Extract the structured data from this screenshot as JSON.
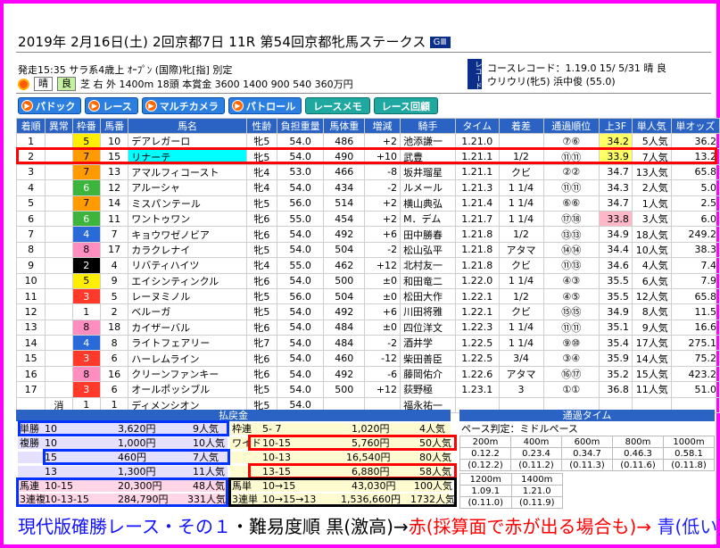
{
  "header": {
    "title": "2019年  2月16日(土)   2回京都7日  11R 第54回京都牝馬ステークス",
    "grade": "GⅢ"
  },
  "conditions": {
    "line1": "発走15:35  サラ系4歳上 ｵｰﾌﾟﾝ (国際)牝[指] 別定",
    "weather": "晴",
    "going": "良",
    "line2": "芝 右 外 1400m 18頭 本賞金 3600 1400 900 540 360万円"
  },
  "record": {
    "badge": "レコード",
    "line1": "コースレコード：1.19.0  15/ 5/31 晴 良",
    "line2": "ウリウリ(牝5)  浜中俊  (55.0)"
  },
  "nav": [
    {
      "label": "パドック",
      "icon": "play-icon"
    },
    {
      "label": "レース",
      "icon": "play-icon"
    },
    {
      "label": "マルチカメラ",
      "icon": "play-icon"
    },
    {
      "label": "パトロール",
      "icon": "play-icon"
    },
    {
      "label": "レースメモ",
      "icon": ""
    },
    {
      "label": "レース回顧",
      "icon": ""
    }
  ],
  "columns": [
    "着順",
    "異常",
    "枠番",
    "馬番",
    "馬名",
    "性齢",
    "負担重量",
    "馬体重",
    "増減",
    "騎手",
    "タイム",
    "着差",
    "通過順位",
    "上3F",
    "単人気",
    "単オッズ"
  ],
  "rows": [
    [
      "1",
      "",
      "5",
      "10",
      "デアレガーロ",
      "牝5",
      "54.0",
      "486",
      "+2",
      "池添謙一",
      "1.21.0",
      "",
      "⑦⑥",
      "34.2",
      "5人気",
      "36.2"
    ],
    [
      "2",
      "",
      "7",
      "15",
      "リナーテ",
      "牝5",
      "54.0",
      "490",
      "+10",
      "武豊",
      "1.21.1",
      "1/2",
      "⑪⑪",
      "33.9",
      "7人気",
      "13.2"
    ],
    [
      "3",
      "",
      "7",
      "13",
      "アマルフィコースト",
      "牝4",
      "53.0",
      "466",
      "-8",
      "坂井瑠星",
      "1.21.1",
      "クビ",
      "②②",
      "34.7",
      "13人気",
      "65.8"
    ],
    [
      "4",
      "",
      "6",
      "12",
      "アルーシャ",
      "牝4",
      "54.0",
      "434",
      "-2",
      "ルメール",
      "1.21.3",
      "1 1/4",
      "⑪⑪",
      "34.3",
      "2人気",
      "5.0"
    ],
    [
      "5",
      "",
      "7",
      "14",
      "ミスパンテール",
      "牝5",
      "56.0",
      "514",
      "+2",
      "横山典弘",
      "1.21.4",
      "1 1/4",
      "⑥⑥",
      "34.7",
      "1人気",
      "2.5"
    ],
    [
      "6",
      "",
      "6",
      "11",
      "ワントゥワン",
      "牝6",
      "55.0",
      "454",
      "+2",
      "M．デム",
      "1.21.7",
      "1 1/4",
      "⑰⑱",
      "33.8",
      "3人気",
      "6.0"
    ],
    [
      "7",
      "",
      "4",
      "7",
      "キョウワゼノビア",
      "牝6",
      "54.0",
      "492",
      "+6",
      "田中勝春",
      "1.21.8",
      "1/2",
      "⑬⑬",
      "34.9",
      "18人気",
      "249.2"
    ],
    [
      "8",
      "",
      "8",
      "17",
      "カラクレナイ",
      "牝5",
      "54.0",
      "504",
      "-2",
      "松山弘平",
      "1.21.8",
      "アタマ",
      "⑭⑭",
      "34.4",
      "10人気",
      "38.3"
    ],
    [
      "9",
      "",
      "2",
      "4",
      "リバティハイツ",
      "牝4",
      "55.0",
      "462",
      "+12",
      "北村友一",
      "1.21.8",
      "クビ",
      "⑪⑬",
      "34.6",
      "4人気",
      "7.4"
    ],
    [
      "10",
      "",
      "5",
      "9",
      "エイシンティンクル",
      "牝6",
      "54.0",
      "500",
      "±0",
      "和田竜二",
      "1.22.0",
      "1 1/4",
      "④③",
      "35.5",
      "6人気",
      "7.9"
    ],
    [
      "11",
      "",
      "3",
      "5",
      "レーヌミノル",
      "牝5",
      "56.0",
      "504",
      "±0",
      "松田大作",
      "1.22.1",
      "1/2",
      "④⑤",
      "35.5",
      "12人気",
      "65.8"
    ],
    [
      "12",
      "",
      "1",
      "2",
      "ベルーガ",
      "牝5",
      "54.0",
      "492",
      "+6",
      "川田将雅",
      "1.22.1",
      "クビ",
      "⑮⑮",
      "34.9",
      "8人気",
      "11.5"
    ],
    [
      "13",
      "",
      "8",
      "18",
      "カイザーバル",
      "牝6",
      "54.0",
      "484",
      "±0",
      "四位洋文",
      "1.22.3",
      "1 1/4",
      "⑪⑪",
      "35.1",
      "9人気",
      "16.6"
    ],
    [
      "14",
      "",
      "4",
      "8",
      "ライトフェアリー",
      "牝7",
      "54.0",
      "484",
      "-2",
      "酒井学",
      "1.22.5",
      "1 1/4",
      "⑨⑩",
      "35.4",
      "17人気",
      "275.1"
    ],
    [
      "15",
      "",
      "3",
      "6",
      "ハーレムライン",
      "牝6",
      "54.0",
      "460",
      "-12",
      "柴田善臣",
      "1.22.5",
      "3/4",
      "③④",
      "35.9",
      "14人気",
      "75.2"
    ],
    [
      "16",
      "",
      "8",
      "16",
      "クリーンファンキー",
      "牝6",
      "54.0",
      "492",
      "-6",
      "藤岡佑介",
      "1.22.6",
      "アタマ",
      "⑯⑰",
      "35.2",
      "15人気",
      "423.2"
    ],
    [
      "17",
      "",
      "3",
      "6",
      "オールポッシブル",
      "牝5",
      "54.0",
      "500",
      "+12",
      "荻野極",
      "1.23.1",
      "3",
      "①①",
      "36.8",
      "11人気",
      "51.0"
    ],
    [
      "",
      "消",
      "1",
      "1",
      "ディメンシオン",
      "牝5",
      "54.0",
      "",
      "",
      "福永祐一",
      "",
      "",
      "",
      "",
      "",
      ""
    ]
  ],
  "payout": {
    "header": "払戻金",
    "tansho": {
      "label": "単勝",
      "combo": "10",
      "amount": "3,620円",
      "pop": "9人気"
    },
    "fukusho": [
      {
        "label": "複勝",
        "combo": "10",
        "amount": "1,000円",
        "pop": "10人気"
      },
      {
        "label": "",
        "combo": "15",
        "amount": "460円",
        "pop": "7人気"
      },
      {
        "label": "",
        "combo": "13",
        "amount": "1,300円",
        "pop": "11人気"
      }
    ],
    "wakuren": {
      "label": "枠連",
      "combo": "5- 7",
      "amount": "1,020円",
      "pop": "4人気"
    },
    "wide": [
      {
        "label": "ワイド",
        "combo": "10-15",
        "amount": "5,760円",
        "pop": "50人気"
      },
      {
        "label": "",
        "combo": "10-13",
        "amount": "16,540円",
        "pop": "80人気"
      },
      {
        "label": "",
        "combo": "13-15",
        "amount": "6,880円",
        "pop": "58人気"
      }
    ],
    "umaren": {
      "label": "馬連",
      "combo": "10-15",
      "amount": "20,300円",
      "pop": "48人気"
    },
    "sanrenpuku": {
      "label": "3連複",
      "combo": "10-13-15",
      "amount": "284,790円",
      "pop": "331人気"
    },
    "umatan": {
      "label": "馬単",
      "combo": "10→15",
      "amount": "43,030円",
      "pop": "100人気"
    },
    "sanrentan": {
      "label": "3連単",
      "combo": "10→15→13",
      "amount": "1,536,660円",
      "pop": "1732人気"
    }
  },
  "times": {
    "header": "通過タイム",
    "pace": "ペース判定：ミドルペース",
    "dist_row1": [
      "200m",
      "400m",
      "600m",
      "800m",
      "1000m"
    ],
    "cum_row1": [
      "0.12.2",
      "0.23.4",
      "0.34.7",
      "0.46.3",
      "0.58.1"
    ],
    "lap_row1": [
      "(0.12.2)",
      "(0.11.2)",
      "(0.11.3)",
      "(0.11.6)",
      "(0.11.8)"
    ],
    "dist_row2": [
      "1200m",
      "1400m"
    ],
    "cum_row2": [
      "1.09.1",
      "1.21.0"
    ],
    "lap_row2": [
      "(0.11.0)",
      "(0.11.9)"
    ]
  },
  "caption": {
    "part1": "現代版確勝レース・その１",
    "part2": "・難易度順 黒(激高)→",
    "part3": "赤(採算面で赤が出る場合も)→",
    "part4": " 青(低い)"
  },
  "colors": {
    "frame": "#ff00ff",
    "header_blue": "#2a63c4",
    "highlight_red": "#ff0000",
    "box_blue": "#0033ff",
    "box_black": "#000000"
  }
}
